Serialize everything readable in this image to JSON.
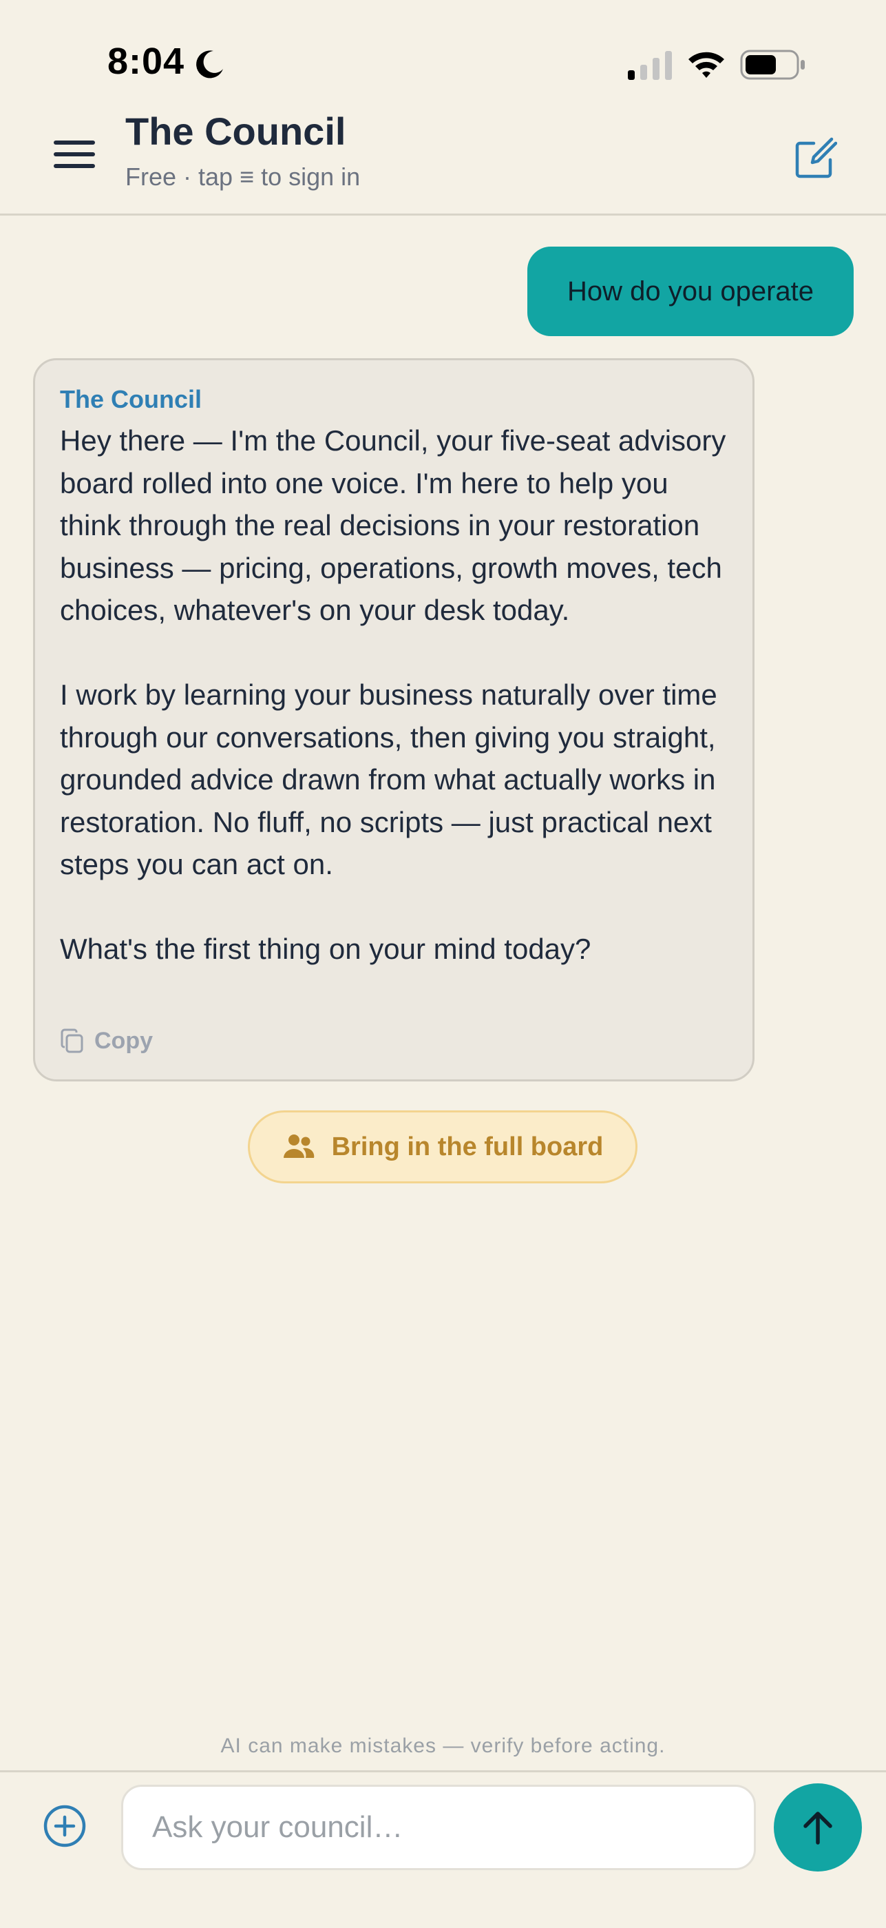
{
  "status_bar": {
    "time": "8:04"
  },
  "header": {
    "title": "The Council",
    "subtitle": "Free · tap ≡ to sign in"
  },
  "messages": {
    "user": "How do you operate",
    "assistant": {
      "name": "The Council",
      "paragraphs": [
        "Hey there — I'm the Council, your five-seat advisory board rolled into one voice. I'm here to help you think through the real decisions in your restoration business — pricing, operations, growth moves, tech choices, whatever's on your desk today.",
        "I work by learning your business naturally over time through our conversations, then giving you straight, grounded advice drawn from what actually works in restoration. No fluff, no scripts — just practical next steps you can act on.",
        "What's the first thing on your mind today?"
      ],
      "copy_label": "Copy"
    }
  },
  "board_button": {
    "label": "Bring in the full board"
  },
  "footer": {
    "disclaimer": "AI can make mistakes — verify before acting.",
    "input_placeholder": "Ask your council…"
  },
  "colors": {
    "background": "#f5f1e6",
    "accent_teal": "#12a5a3",
    "assistant_name": "#2f7fb4",
    "board_button_bg": "#fbecc9",
    "board_button_text": "#b8862c"
  },
  "icons": {
    "status": [
      "moon-icon",
      "signal-icon",
      "wifi-icon",
      "battery-icon"
    ],
    "header": [
      "menu-icon",
      "compose-icon"
    ],
    "message": [
      "copy-icon"
    ],
    "board": [
      "people-icon"
    ],
    "composer": [
      "add-icon",
      "arrow-up-icon"
    ]
  }
}
